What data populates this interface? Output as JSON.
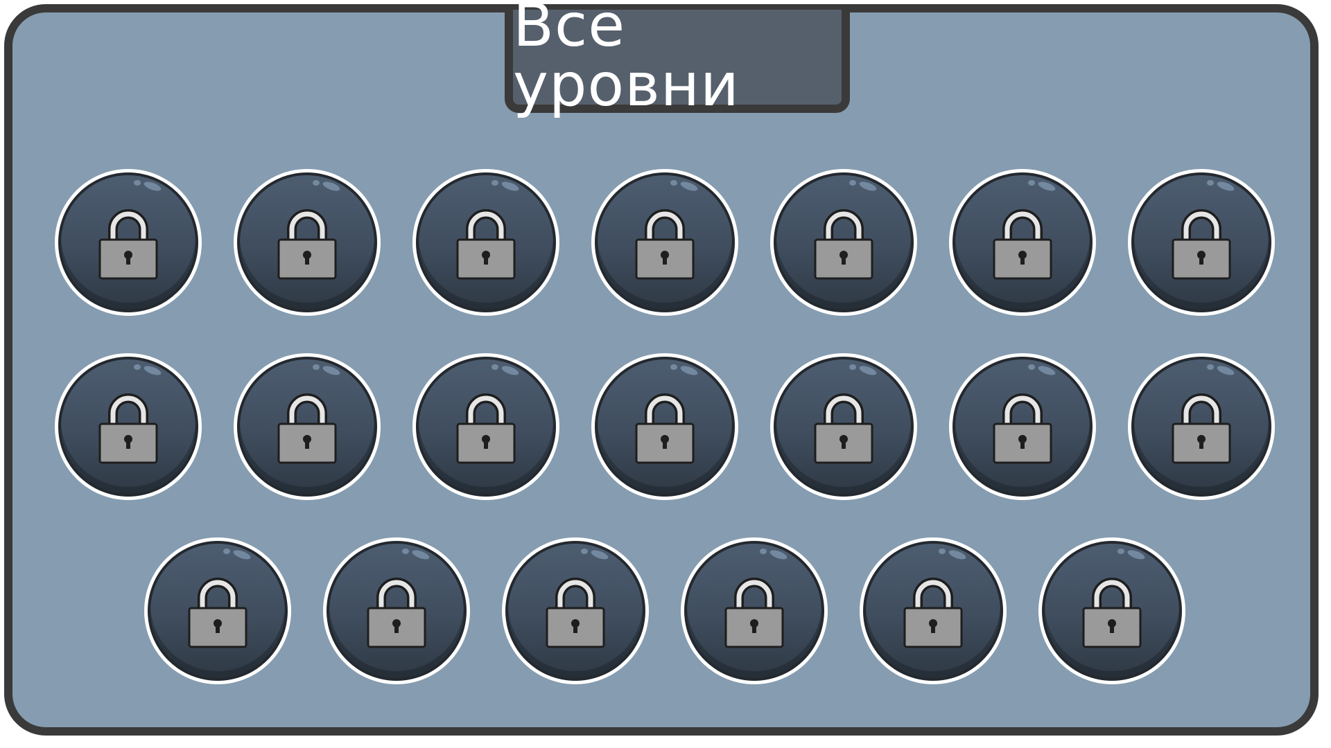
{
  "title": "Все уровни",
  "levels": [
    {
      "state": "locked",
      "icon": "lock-icon"
    },
    {
      "state": "locked",
      "icon": "lock-icon"
    },
    {
      "state": "locked",
      "icon": "lock-icon"
    },
    {
      "state": "locked",
      "icon": "lock-icon"
    },
    {
      "state": "locked",
      "icon": "lock-icon"
    },
    {
      "state": "locked",
      "icon": "lock-icon"
    },
    {
      "state": "locked",
      "icon": "lock-icon"
    },
    {
      "state": "locked",
      "icon": "lock-icon"
    },
    {
      "state": "locked",
      "icon": "lock-icon"
    },
    {
      "state": "locked",
      "icon": "lock-icon"
    },
    {
      "state": "locked",
      "icon": "lock-icon"
    },
    {
      "state": "locked",
      "icon": "lock-icon"
    },
    {
      "state": "locked",
      "icon": "lock-icon"
    },
    {
      "state": "locked",
      "icon": "lock-icon"
    },
    {
      "state": "locked",
      "icon": "lock-icon"
    },
    {
      "state": "locked",
      "icon": "lock-icon"
    },
    {
      "state": "locked",
      "icon": "lock-icon"
    },
    {
      "state": "locked",
      "icon": "lock-icon"
    },
    {
      "state": "locked",
      "icon": "lock-icon"
    },
    {
      "state": "locked",
      "icon": "lock-icon"
    }
  ],
  "colors": {
    "panel_background": "#869cb0",
    "panel_border": "#3a3a3a",
    "title_background": "#56606c",
    "button_face": "#3f4d5e",
    "lock_body": "#9a9a9a"
  }
}
